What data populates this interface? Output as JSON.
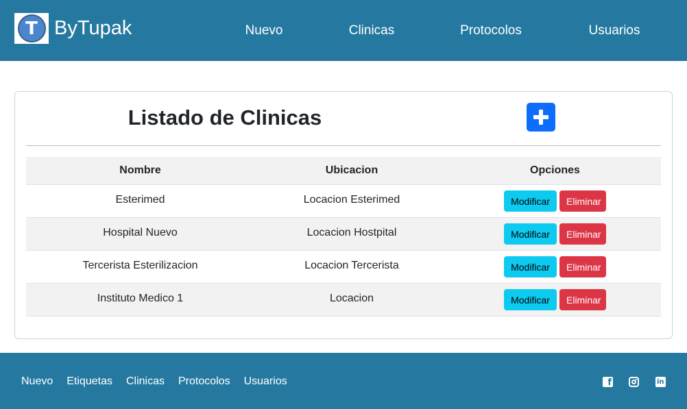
{
  "header": {
    "brand_letter": "T",
    "brand_name": "ByTupak",
    "nav": [
      "Nuevo",
      "Clinicas",
      "Protocolos",
      "Usuarios"
    ]
  },
  "card": {
    "title": "Listado de Clinicas",
    "add_button_icon": "plus-icon",
    "columns": [
      "Nombre",
      "Ubicacion",
      "Opciones"
    ],
    "rows": [
      {
        "nombre": "Esterimed",
        "ubicacion": "Locacion Esterimed"
      },
      {
        "nombre": "Hospital Nuevo",
        "ubicacion": "Locacion Hostpital"
      },
      {
        "nombre": "Tercerista Esterilizacion",
        "ubicacion": "Locacion Tercerista"
      },
      {
        "nombre": "Instituto Medico 1",
        "ubicacion": "Locacion"
      }
    ],
    "modify_label": "Modificar",
    "delete_label": "Eliminar"
  },
  "footer": {
    "links": [
      "Nuevo",
      "Etiquetas",
      "Clinicas",
      "Protocolos",
      "Usuarios"
    ],
    "social_icons": [
      "facebook-icon",
      "instagram-icon",
      "linkedin-icon"
    ]
  },
  "colors": {
    "primary_bar": "#2579a0",
    "add_button": "#0d6efd",
    "modify_button": "#0dcaf0",
    "delete_button": "#dc3545"
  }
}
